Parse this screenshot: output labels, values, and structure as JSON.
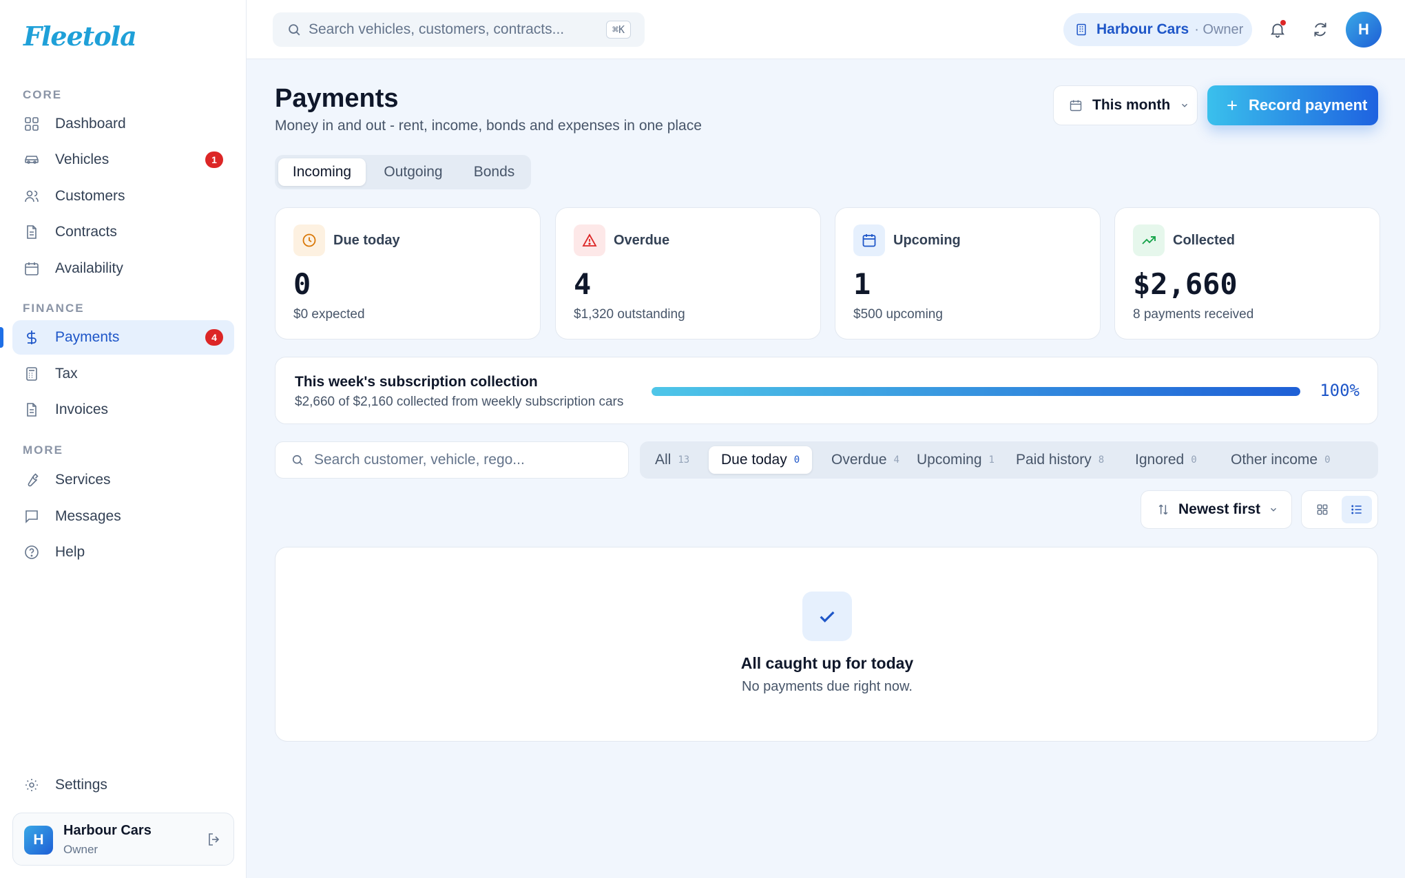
{
  "app": {
    "logo": "Fleetola"
  },
  "sidebar": {
    "sections": {
      "core": "CORE",
      "finance": "FINANCE",
      "more": "MORE"
    },
    "items": [
      {
        "label": "Dashboard",
        "icon": "grid-icon"
      },
      {
        "label": "Vehicles",
        "icon": "car-icon",
        "badge": "1"
      },
      {
        "label": "Customers",
        "icon": "users-icon"
      },
      {
        "label": "Contracts",
        "icon": "file-icon"
      },
      {
        "label": "Availability",
        "icon": "calendar-icon"
      },
      {
        "label": "Payments",
        "icon": "dollar-icon",
        "badge": "4",
        "active": true
      },
      {
        "label": "Tax",
        "icon": "calculator-icon"
      },
      {
        "label": "Invoices",
        "icon": "file-icon"
      },
      {
        "label": "Services",
        "icon": "wrench-icon"
      },
      {
        "label": "Messages",
        "icon": "message-icon"
      },
      {
        "label": "Help",
        "icon": "help-icon"
      },
      {
        "label": "Settings",
        "icon": "gear-icon"
      }
    ],
    "account": {
      "initial": "H",
      "name": "Harbour Cars",
      "role": "Owner"
    }
  },
  "topbar": {
    "search_placeholder": "Search vehicles, customers, contracts...",
    "shortcut": "⌘K",
    "org": {
      "name": "Harbour Cars",
      "role": "· Owner"
    },
    "user_initial": "H"
  },
  "page": {
    "title": "Payments",
    "subtitle": "Money in and out - rent, income, bonds and expenses in one place",
    "period": "This month",
    "record_label": "Record payment",
    "tabs": [
      "Incoming",
      "Outgoing",
      "Bonds"
    ],
    "active_tab": "Incoming"
  },
  "stats": [
    {
      "label": "Due today",
      "value": "0",
      "note": "$0 expected",
      "icon": "clock-icon",
      "color": "#d97706",
      "bg": "#fdf1e1"
    },
    {
      "label": "Overdue",
      "value": "4",
      "note": "$1,320 outstanding",
      "icon": "alert-icon",
      "color": "#dc2626",
      "bg": "#fde8e8"
    },
    {
      "label": "Upcoming",
      "value": "1",
      "note": "$500 upcoming",
      "icon": "calendar-icon",
      "color": "#1e56c8",
      "bg": "#e6f0fd"
    },
    {
      "label": "Collected",
      "value": "$2,660",
      "note": "8 payments received",
      "icon": "trending-up-icon",
      "color": "#16a34a",
      "bg": "#e6f7ec"
    }
  ],
  "collection": {
    "title": "This week's subscription collection",
    "subtitle": "$2,660 of $2,160 collected from weekly subscription cars",
    "percent_label": "100%",
    "progress": 1.0
  },
  "list": {
    "search_placeholder": "Search customer, vehicle, rego...",
    "filters": [
      {
        "label": "All",
        "count": "13"
      },
      {
        "label": "Due today",
        "count": "0",
        "active": true
      },
      {
        "label": "Overdue",
        "count": "4"
      },
      {
        "label": "Upcoming",
        "count": "1"
      },
      {
        "label": "Paid history",
        "count": "8"
      },
      {
        "label": "Ignored",
        "count": "0"
      },
      {
        "label": "Other income",
        "count": "0"
      }
    ],
    "sort_label": "Newest first",
    "view_mode": "list"
  },
  "empty_state": {
    "title": "All caught up for today",
    "subtitle": "No payments due right now."
  },
  "colors": {
    "accent": "#1e56c8",
    "badge": "#dc2626",
    "brand": "#1fa0d8"
  }
}
